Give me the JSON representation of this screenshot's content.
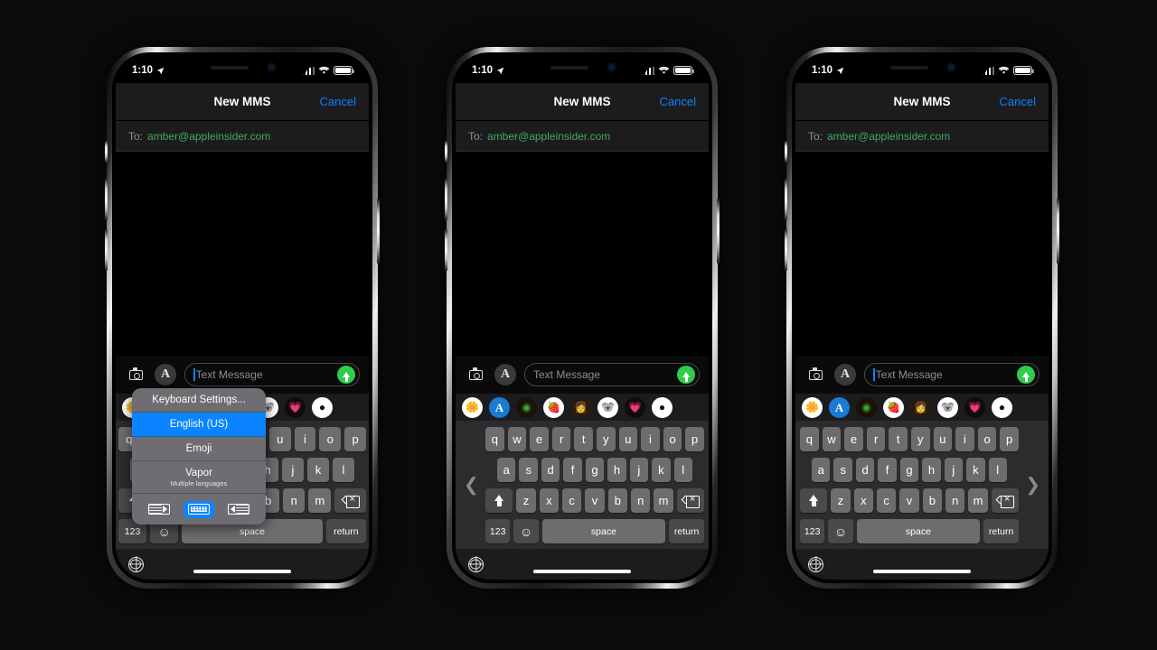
{
  "status_bar": {
    "time": "1:10",
    "location_icon": "location-arrow-icon",
    "signal_icon": "cellular-bars-icon",
    "wifi_icon": "wifi-icon",
    "battery_icon": "battery-icon"
  },
  "nav": {
    "title": "New MMS",
    "cancel_label": "Cancel",
    "cancel_color": "#0a84ff"
  },
  "to_field": {
    "label": "To:",
    "recipient": "amber@appleinsider.com",
    "recipient_color": "#41a85f"
  },
  "input_bar": {
    "camera_icon": "camera-icon",
    "appstore_icon": "app-store-icon",
    "appstore_glyph": "A",
    "placeholder": "Text Message",
    "send_icon": "send-arrow-icon",
    "send_color": "#2ecc4a"
  },
  "app_drawer": {
    "items": [
      {
        "name": "photos",
        "glyph": "🌼",
        "bg": "#ffffff"
      },
      {
        "name": "app-store",
        "glyph": "A",
        "bg": "#1a7bd4"
      },
      {
        "name": "digital-touch",
        "glyph": "◉",
        "bg": "#1a1208"
      },
      {
        "name": "food-stickers",
        "glyph": "🍓",
        "bg": "#ffffff"
      },
      {
        "name": "memoji",
        "glyph": "👩",
        "bg": "#2a1a0a"
      },
      {
        "name": "animoji-koala",
        "glyph": "🐨",
        "bg": "#ffffff"
      },
      {
        "name": "hearts-stickers",
        "glyph": "💗",
        "bg": "#0d0d0d"
      },
      {
        "name": "more-apps",
        "glyph": "●",
        "bg": "#ffffff"
      }
    ]
  },
  "keyboard": {
    "row1": [
      "q",
      "w",
      "e",
      "r",
      "t",
      "y",
      "u",
      "i",
      "o",
      "p"
    ],
    "row2": [
      "a",
      "s",
      "d",
      "f",
      "g",
      "h",
      "j",
      "k",
      "l"
    ],
    "row3": [
      "z",
      "x",
      "c",
      "v",
      "b",
      "n",
      "m"
    ],
    "shift_icon": "shift-key-icon",
    "delete_icon": "backspace-key-icon",
    "numbers_label": "123",
    "emoji_icon": "emoji-key-icon",
    "emoji_glyph": "☺",
    "space_label": "space",
    "return_label": "return",
    "chevron_left_glyph": "❮",
    "chevron_right_glyph": "❯"
  },
  "bottom_bar": {
    "globe_icon": "globe-keyboard-switch-icon",
    "home_indicator": "home-indicator"
  },
  "keyboard_popup": {
    "settings_label": "Keyboard Settings...",
    "items": [
      {
        "label": "English (US)",
        "selected": true
      },
      {
        "label": "Emoji",
        "selected": false
      }
    ],
    "third_party": {
      "label": "Vapor",
      "sublabel": "Multiple languages"
    },
    "layouts": [
      {
        "name": "keyboard-dock-left-icon",
        "active": false
      },
      {
        "name": "keyboard-full-width-icon",
        "active": true
      },
      {
        "name": "keyboard-dock-right-icon",
        "active": false
      }
    ],
    "selected_color": "#0a84ff"
  },
  "phones": [
    {
      "id": "phone-1",
      "keyboard_mode": "full",
      "popup_visible": true
    },
    {
      "id": "phone-2",
      "keyboard_mode": "right",
      "popup_visible": false
    },
    {
      "id": "phone-3",
      "keyboard_mode": "left",
      "popup_visible": false
    }
  ]
}
